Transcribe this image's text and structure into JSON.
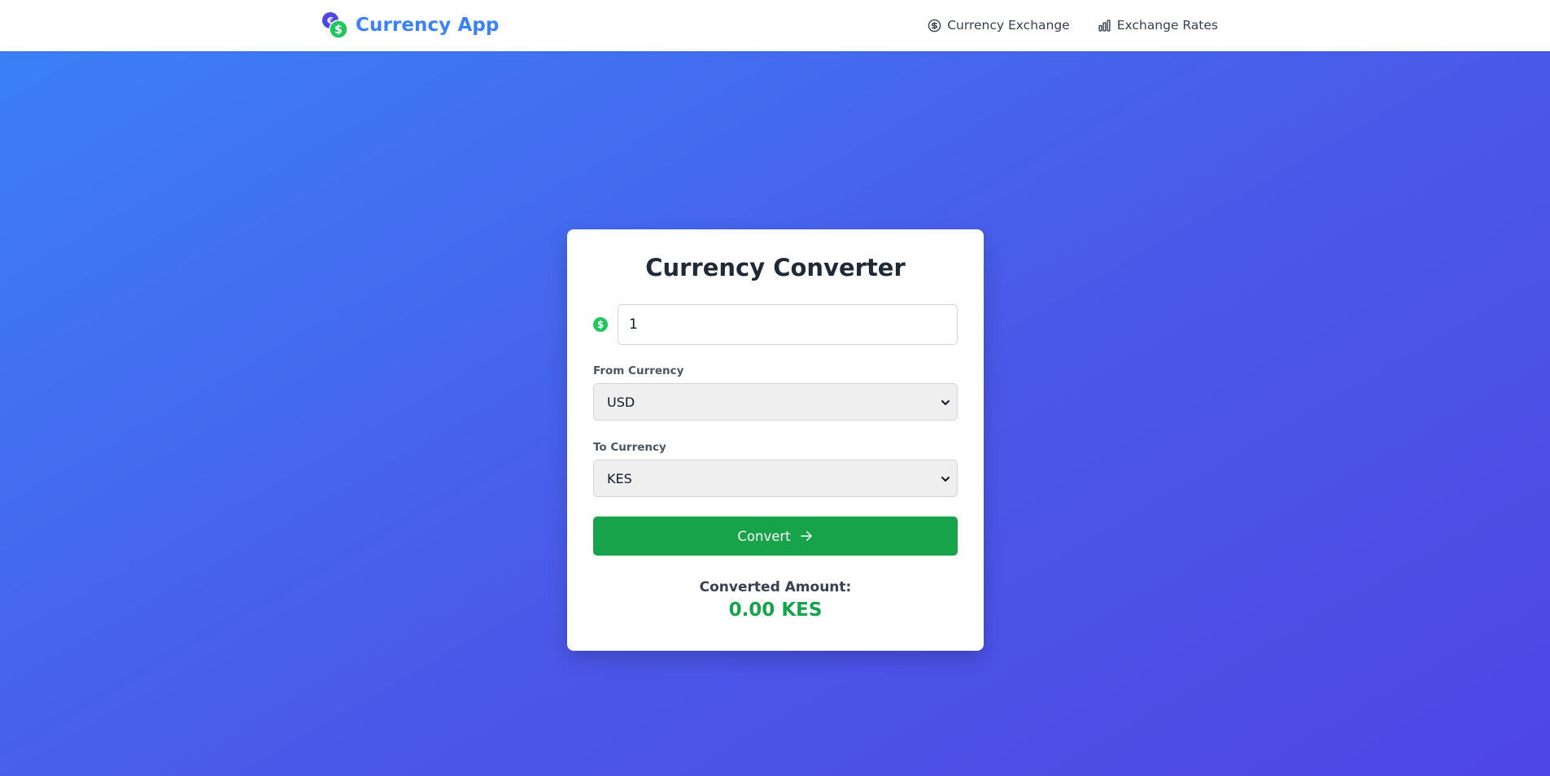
{
  "app": {
    "title": "Currency App",
    "logo_icon": "coins-icon",
    "accent_color": "#3b82f6"
  },
  "nav": {
    "items": [
      {
        "label": "Currency Exchange",
        "icon": "dollar-circle-icon"
      },
      {
        "label": "Exchange Rates",
        "icon": "bar-chart-icon"
      }
    ]
  },
  "converter": {
    "title": "Currency Converter",
    "amount": {
      "value": "1",
      "icon": "dollar-circle-icon"
    },
    "from": {
      "label": "From Currency",
      "selected": "USD"
    },
    "to": {
      "label": "To Currency",
      "selected": "KES"
    },
    "convert_button": {
      "label": "Convert",
      "icon": "arrow-right-icon",
      "color": "#16a34a"
    },
    "result": {
      "label": "Converted Amount:",
      "value": "0.00 KES",
      "color": "#16a34a"
    }
  }
}
